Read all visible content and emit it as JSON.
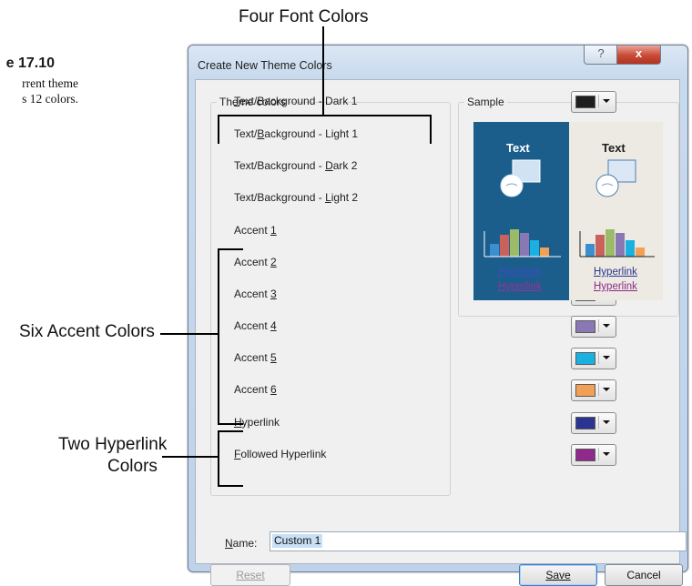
{
  "callouts": {
    "four_font_colors": "Four Font Colors",
    "six_accent_colors": "Six Accent Colors",
    "two_hyperlink_line1": "Two Hyperlink",
    "two_hyperlink_line2": "Colors"
  },
  "figure": {
    "number": "e 17.10",
    "line1": "rrent theme",
    "line2": "s 12 colors."
  },
  "dialog": {
    "title": "Create New Theme Colors",
    "help_glyph": "?",
    "close_glyph": "x",
    "theme_colors_legend": "Theme colors",
    "sample_legend": "Sample",
    "rows": [
      {
        "pre": "",
        "key": "T",
        "post": "ext/Background - Dark 1",
        "color": "#1e1e1e"
      },
      {
        "pre": "Text/",
        "key": "B",
        "post": "ackground - Light 1",
        "color": "#ffffff"
      },
      {
        "pre": "Text/Background - ",
        "key": "D",
        "post": "ark 2",
        "color": "#1f5c8a"
      },
      {
        "pre": "Text/Background - ",
        "key": "L",
        "post": "ight 2",
        "color": "#ecebe6"
      },
      {
        "pre": "Accent ",
        "key": "1",
        "post": "",
        "color": "#3c8fce"
      },
      {
        "pre": "Accent ",
        "key": "2",
        "post": "",
        "color": "#c9625c"
      },
      {
        "pre": "Accent ",
        "key": "3",
        "post": "",
        "color": "#9bbb69"
      },
      {
        "pre": "Accent ",
        "key": "4",
        "post": "",
        "color": "#8a78b4"
      },
      {
        "pre": "Accent ",
        "key": "5",
        "post": "",
        "color": "#1ab1e0"
      },
      {
        "pre": "Accent ",
        "key": "6",
        "post": "",
        "color": "#f2a055"
      },
      {
        "pre": "",
        "key": "H",
        "post": "yperlink",
        "color": "#2b3591"
      },
      {
        "pre": "",
        "key": "F",
        "post": "ollowed Hyperlink",
        "color": "#8f2a8c"
      }
    ],
    "sample": {
      "text_dark": "Text",
      "text_light": "Text",
      "hyperlink": "Hyperlink",
      "followed_hyperlink": "Hyperlink",
      "bar_colors": [
        "#3c8fce",
        "#c9625c",
        "#9bbb69",
        "#8a78b4",
        "#1ab1e0",
        "#f2a055"
      ]
    },
    "name_label_pre": "",
    "name_label_key": "N",
    "name_label_post": "ame:",
    "name_value": "Custom 1",
    "reset_label": "Reset",
    "save_label": "Save",
    "cancel_label": "Cancel"
  }
}
